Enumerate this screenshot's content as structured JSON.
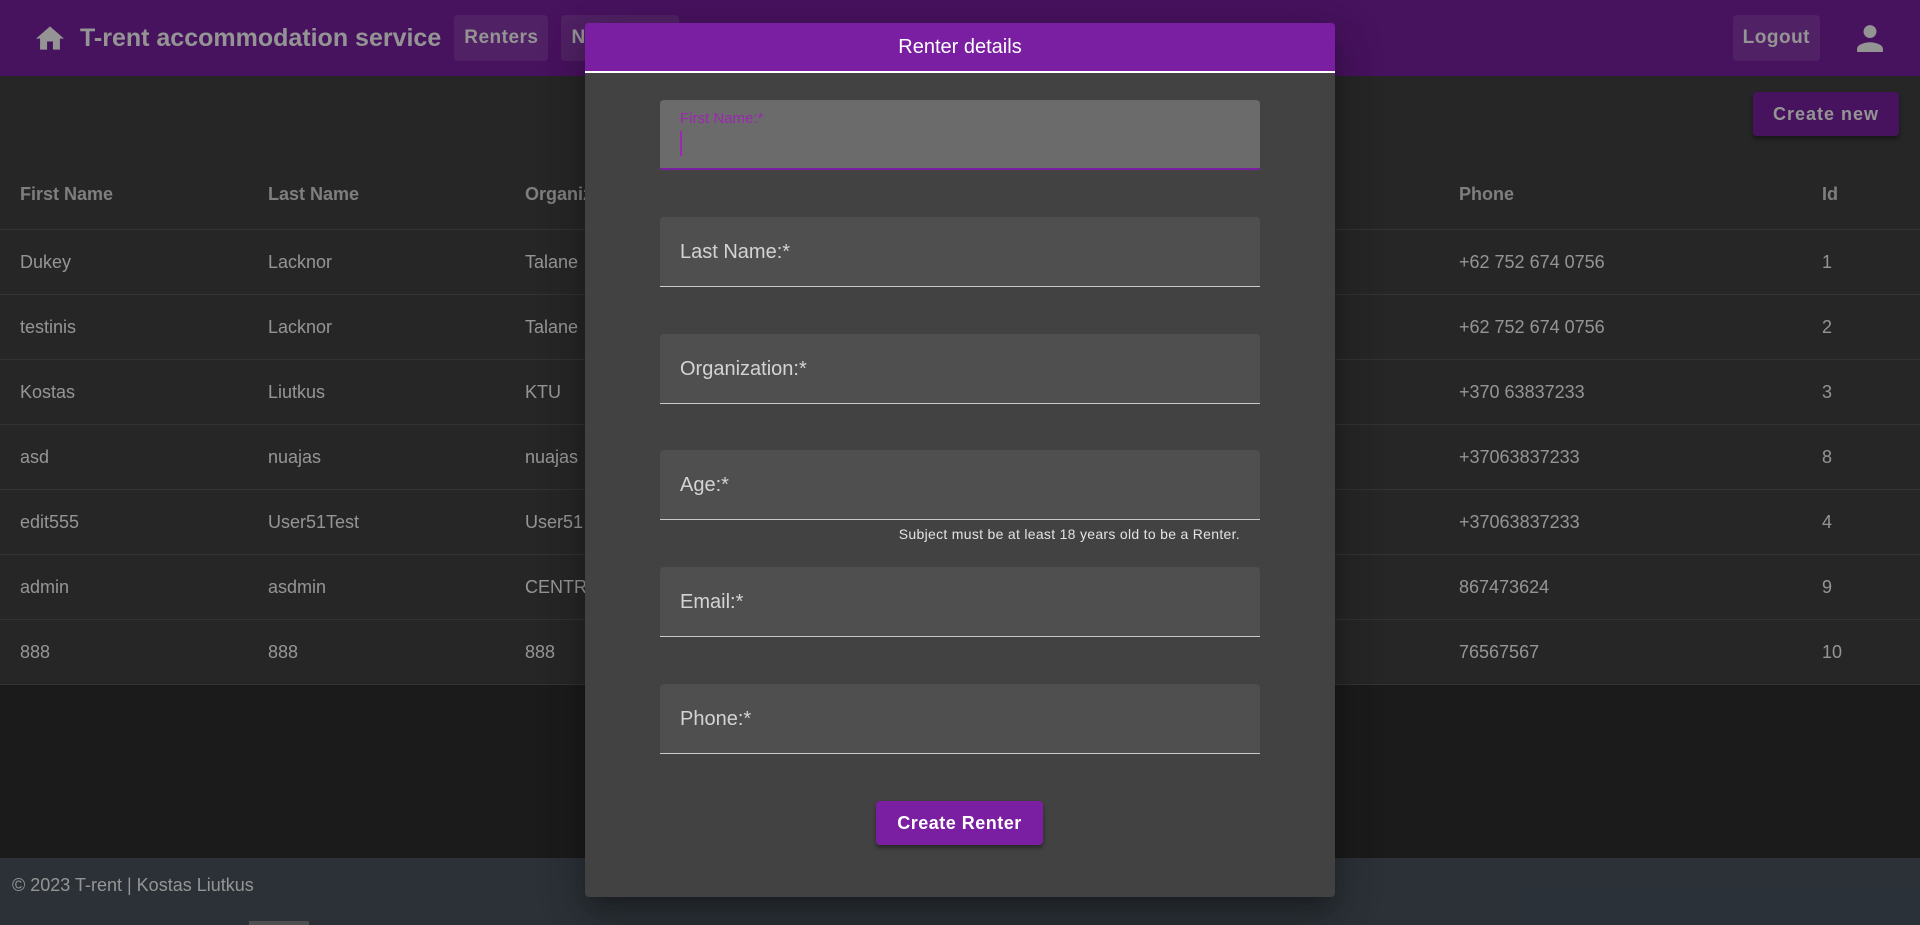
{
  "appbar": {
    "title": "T-rent accommodation service",
    "nav": [
      "Renters",
      "Ne"
    ],
    "logout_label": "Logout",
    "home_icon": "home-icon",
    "account_icon": "account-icon"
  },
  "toolbar": {
    "create_new_label": "Create new"
  },
  "table": {
    "headers": [
      "First Name",
      "Last Name",
      "Organiz",
      "Phone",
      "Id"
    ],
    "rows": [
      [
        "Dukey",
        "Lacknor",
        "Talane",
        "+62 752 674 0756",
        "1"
      ],
      [
        "testinis",
        "Lacknor",
        "Talane",
        "+62 752 674 0756",
        "2"
      ],
      [
        "Kostas",
        "Liutkus",
        "KTU",
        "+370 63837233",
        "3"
      ],
      [
        "asd",
        "nuajas",
        "nuajas",
        "+37063837233",
        "8"
      ],
      [
        "edit555",
        "User51Test",
        "User51",
        "+37063837233",
        "4"
      ],
      [
        "admin",
        "asdmin",
        "CENTR",
        "867473624",
        "9"
      ],
      [
        "888",
        "888",
        "888",
        "76567567",
        "10"
      ]
    ]
  },
  "dialog": {
    "title": "Renter details",
    "fields": [
      {
        "label": "First Name:*",
        "value": ""
      },
      {
        "label": "Last Name:*",
        "value": ""
      },
      {
        "label": "Organization:*",
        "value": ""
      },
      {
        "label": "Age:*",
        "value": ""
      },
      {
        "label": "Email:*",
        "value": ""
      },
      {
        "label": "Phone:*",
        "value": ""
      }
    ],
    "age_hint": "Subject must be at least 18 years old to be a Renter.",
    "submit_label": "Create Renter"
  },
  "footer": {
    "text": "© 2023 T-rent | Kostas Liutkus"
  },
  "colors": {
    "primary": "#7b1fa2",
    "surface": "#424242",
    "background": "#303030",
    "footer": "#4a5560"
  }
}
